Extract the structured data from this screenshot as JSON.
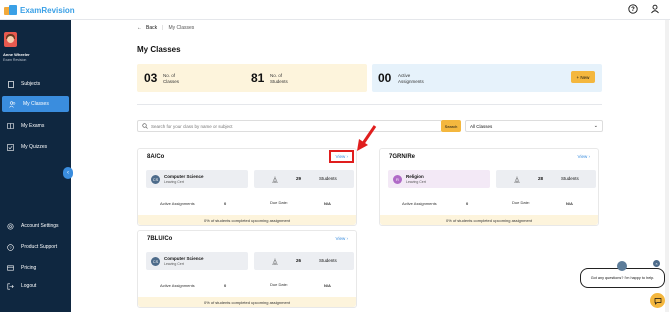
{
  "app": {
    "logo_text": "ExamRevision"
  },
  "user": {
    "name": "Anne Wheeler",
    "role": "Exam Revision"
  },
  "sidebar": {
    "items": [
      {
        "label": "Subjects",
        "icon": "book-icon"
      },
      {
        "label": "My Classes",
        "icon": "users-icon",
        "active": true
      },
      {
        "label": "My Exams",
        "icon": "exam-icon"
      },
      {
        "label": "My Quizzes",
        "icon": "quiz-icon"
      }
    ],
    "bottom": [
      {
        "label": "Account Settings",
        "icon": "gear-icon"
      },
      {
        "label": "Product Support",
        "icon": "help-icon"
      },
      {
        "label": "Pricing",
        "icon": "card-icon"
      },
      {
        "label": "Logout",
        "icon": "logout-icon"
      }
    ]
  },
  "breadcrumb": {
    "back": "Back",
    "current": "My Classes"
  },
  "page_title": "My Classes",
  "stats": {
    "classes_num": "03",
    "classes_label_1": "No. of",
    "classes_label_2": "Classes",
    "students_num": "81",
    "students_label_1": "No. of",
    "students_label_2": "Students",
    "assign_num": "00",
    "assign_label_1": "Active",
    "assign_label_2": "Assignments",
    "new_button": "+ New"
  },
  "search": {
    "placeholder": "Search for your class by name or subject",
    "button": "Search",
    "filter": "All Classes"
  },
  "cards": [
    {
      "name": "8A/Co",
      "view": "View",
      "subject": "Computer Science",
      "level": "Leaving Cert",
      "students": "29",
      "students_label": "Students",
      "active_label": "Active Assignments",
      "active": "0",
      "due_label": "Due Date:",
      "due": "N/A",
      "footer": "0% of students completed upcoming assignment"
    },
    {
      "name": "7GRN/Re",
      "view": "View",
      "subject": "Religion",
      "level": "Leaving Cert",
      "students": "28",
      "students_label": "Students",
      "active_label": "Active Assignments",
      "active": "0",
      "due_label": "Due Date:",
      "due": "N/A",
      "footer": "0% of students completed upcoming assignment"
    },
    {
      "name": "7BLU/Co",
      "view": "View",
      "subject": "Computer Science",
      "level": "Leaving Cert",
      "students": "26",
      "students_label": "Students",
      "active_label": "Active Assignments",
      "active": "0",
      "due_label": "Due Date:",
      "due": "N/A",
      "footer": "0% of students completed upcoming assignment"
    }
  ],
  "chat": {
    "message": "Got any questions? I'm happy to help."
  },
  "colors": {
    "sidebar": "#0f2740",
    "accent": "#3a8dde",
    "yellow": "#f4b73e",
    "annotation": "#e01e1e"
  }
}
